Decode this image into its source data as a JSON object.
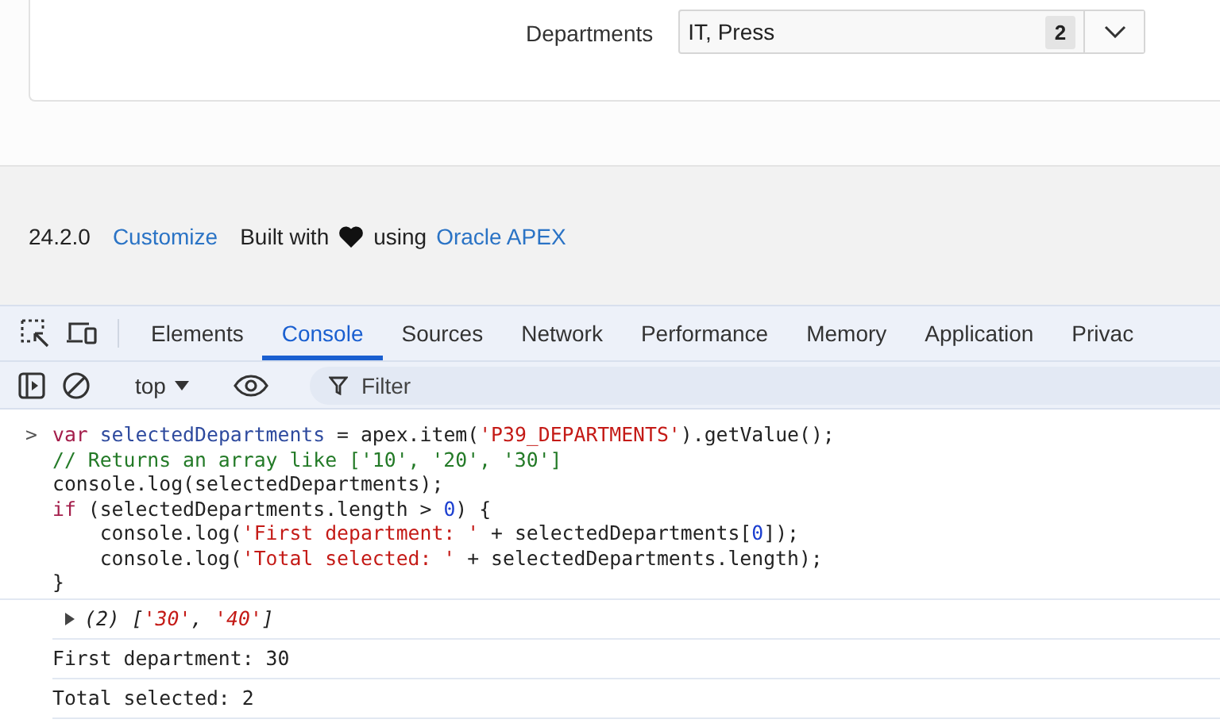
{
  "form": {
    "label": "Departments",
    "value": "IT, Press",
    "count": "2"
  },
  "footer": {
    "version": "24.2.0",
    "customize_link": "Customize",
    "built_with": "Built with",
    "using": "using",
    "apex_link": "Oracle APEX"
  },
  "devtools": {
    "tabs": [
      {
        "label": "Elements",
        "selected": false
      },
      {
        "label": "Console",
        "selected": true
      },
      {
        "label": "Sources",
        "selected": false
      },
      {
        "label": "Network",
        "selected": false
      },
      {
        "label": "Performance",
        "selected": false
      },
      {
        "label": "Memory",
        "selected": false
      },
      {
        "label": "Application",
        "selected": false
      },
      {
        "label": "Privac",
        "selected": false
      }
    ],
    "context": "top",
    "filter_placeholder": "Filter",
    "input_prompt": ">",
    "input_lines": [
      [
        {
          "kind": "keyword",
          "text": "var "
        },
        {
          "kind": "variable",
          "text": "selectedDepartments"
        },
        {
          "kind": "plain",
          "text": " = apex.item("
        },
        {
          "kind": "string",
          "text": "'P39_DEPARTMENTS'"
        },
        {
          "kind": "plain",
          "text": ").getValue();"
        }
      ],
      [
        {
          "kind": "comment",
          "text": "// Returns an array like ['10', '20', '30']"
        }
      ],
      [
        {
          "kind": "plain",
          "text": "console.log(selectedDepartments);"
        }
      ],
      [
        {
          "kind": "keyword",
          "text": "if"
        },
        {
          "kind": "plain",
          "text": " (selectedDepartments.length > "
        },
        {
          "kind": "number",
          "text": "0"
        },
        {
          "kind": "plain",
          "text": ") {"
        }
      ],
      [
        {
          "kind": "plain",
          "text": "    console.log("
        },
        {
          "kind": "string",
          "text": "'First department: '"
        },
        {
          "kind": "plain",
          "text": " + selectedDepartments["
        },
        {
          "kind": "number",
          "text": "0"
        },
        {
          "kind": "plain",
          "text": "]);"
        }
      ],
      [
        {
          "kind": "plain",
          "text": "    console.log("
        },
        {
          "kind": "string",
          "text": "'Total selected: '"
        },
        {
          "kind": "plain",
          "text": " + selectedDepartments.length);"
        }
      ],
      [
        {
          "kind": "plain",
          "text": "}"
        }
      ]
    ],
    "outputs": [
      {
        "kind": "array",
        "expanded": false,
        "tokens": [
          {
            "kind": "italic",
            "text": "(2) ["
          },
          {
            "kind": "string",
            "text": "'30'"
          },
          {
            "kind": "italic",
            "text": ", "
          },
          {
            "kind": "string",
            "text": "'40'"
          },
          {
            "kind": "italic",
            "text": "]"
          }
        ]
      },
      {
        "kind": "log",
        "text": "First department: 30"
      },
      {
        "kind": "log",
        "text": "Total selected: 2"
      }
    ]
  }
}
